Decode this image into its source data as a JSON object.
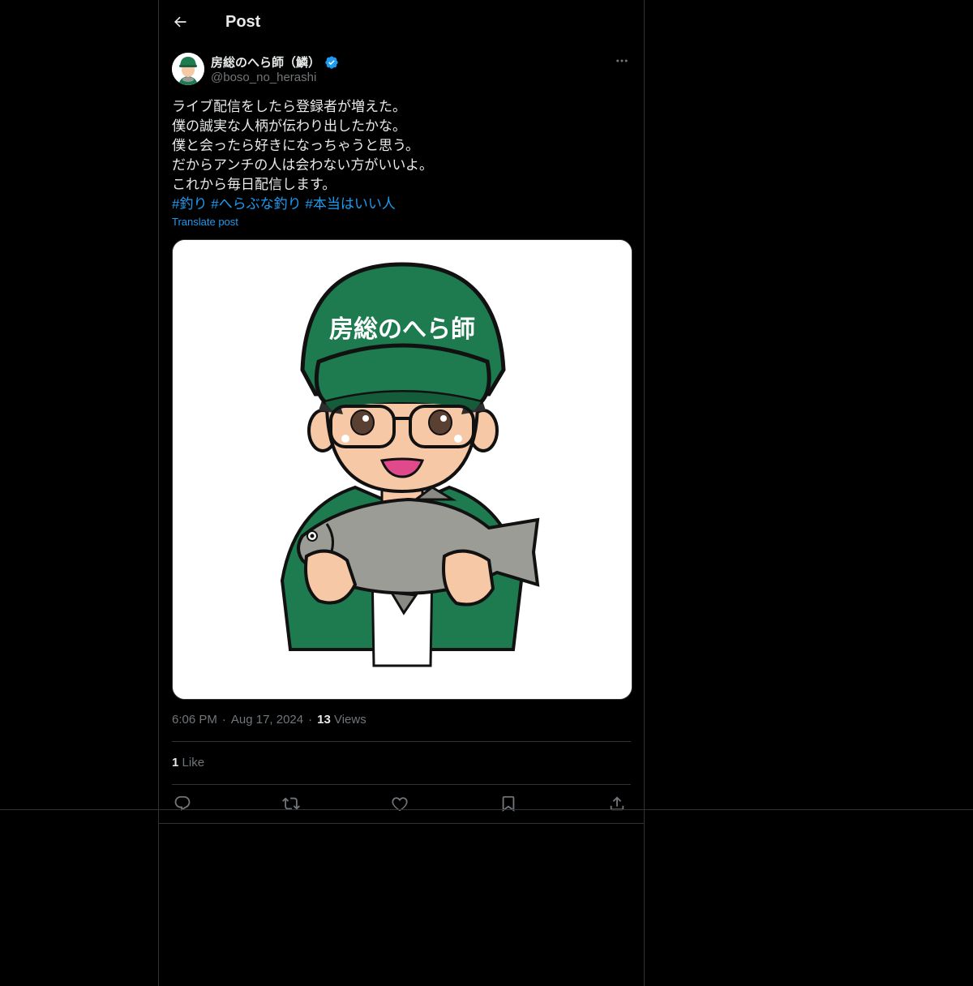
{
  "header": {
    "title": "Post"
  },
  "author": {
    "display_name": "房総のへら師（鱗）",
    "handle": "@boso_no_herashi",
    "avatar_icon": "avatar-fisherman-icon",
    "verified_icon": "verified-badge-icon",
    "verified_color": "#1d9bf0"
  },
  "post": {
    "lines": [
      "ライブ配信をしたら登録者が増えた。",
      "僕の誠実な人柄が伝わり出したかな。",
      "僕と会ったら好きになっちゃうと思う。",
      "だからアンチの人は会わない方がいいよ。",
      "これから毎日配信します。"
    ],
    "hashtags": [
      "#釣り",
      "#へらぶな釣り",
      "#本当はいい人"
    ],
    "translate_label": "Translate post",
    "media": {
      "cap_text": "房総のへら師",
      "description_icon": "fisherman-holding-fish-illustration"
    },
    "time": "6:06 PM",
    "date": "Aug 17, 2024",
    "views_count": "13",
    "views_label": "Views",
    "likes_count": "1",
    "likes_label": "Like"
  },
  "actions": {
    "reply_icon": "reply-icon",
    "repost_icon": "repost-icon",
    "like_icon": "heart-icon",
    "bookmark_icon": "bookmark-icon",
    "share_icon": "share-icon"
  },
  "colors": {
    "background": "#000000",
    "accent": "#1d9bf0",
    "border": "#2f3336",
    "secondary_text": "#71767b",
    "cap_green": "#1e7a4f"
  }
}
